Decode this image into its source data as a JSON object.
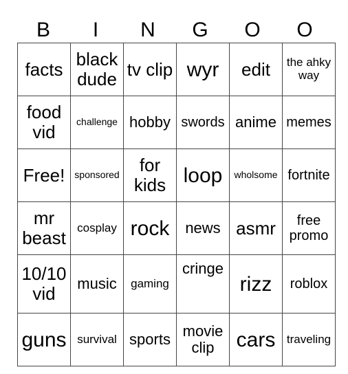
{
  "header": [
    "B",
    "I",
    "N",
    "G",
    "O",
    "O"
  ],
  "rows": [
    [
      "facts",
      "black dude",
      "tv clip",
      "wyr",
      "edit",
      "the ahky way"
    ],
    [
      "food vid",
      "challenge",
      "hobby",
      "swords",
      "anime",
      "memes"
    ],
    [
      "Free!",
      "sponsored",
      "for kids",
      "loop",
      "wholsome",
      "fortnite"
    ],
    [
      "mr beast",
      "cosplay",
      "rock",
      "news",
      "asmr",
      "free promo"
    ],
    [
      "10/10 vid",
      "music",
      "gaming",
      "cringe",
      "rizz",
      "roblox"
    ],
    [
      "guns",
      "survival",
      "sports",
      "movie clip",
      "cars",
      "traveling"
    ]
  ]
}
